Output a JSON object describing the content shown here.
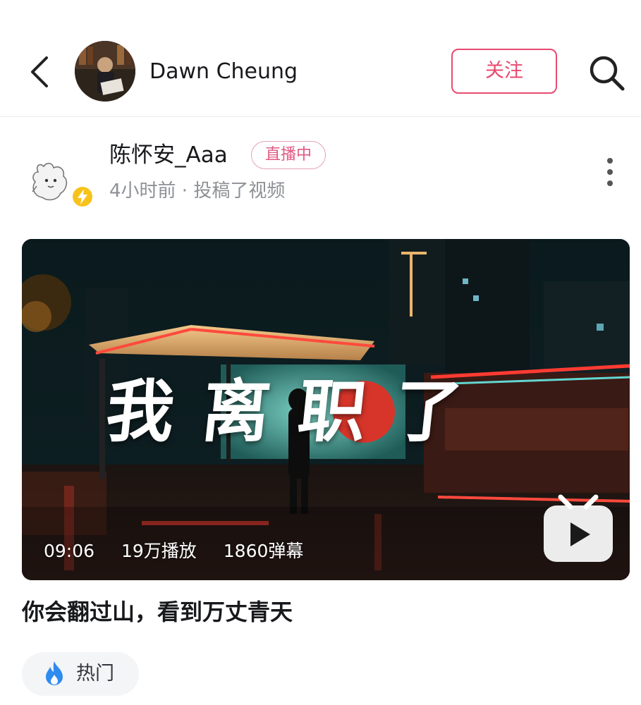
{
  "header": {
    "user_name": "Dawn Cheung",
    "follow_label": "关注"
  },
  "post": {
    "author_name": "陈怀安_Aaa",
    "live_badge": "直播中",
    "meta": "4小时前 · 投稿了视频"
  },
  "video": {
    "overlay_title": "我离职了",
    "duration": "09:06",
    "plays": "19万播放",
    "danmaku": "1860弹幕",
    "caption": "你会翻过山，看到万丈青天"
  },
  "tags": {
    "hot_label": "热门"
  },
  "colors": {
    "accent_pink": "#e84a6e",
    "live_pink": "#e05a82",
    "hot_blue": "#2f8bf0",
    "badge_yellow": "#f7c21a"
  }
}
